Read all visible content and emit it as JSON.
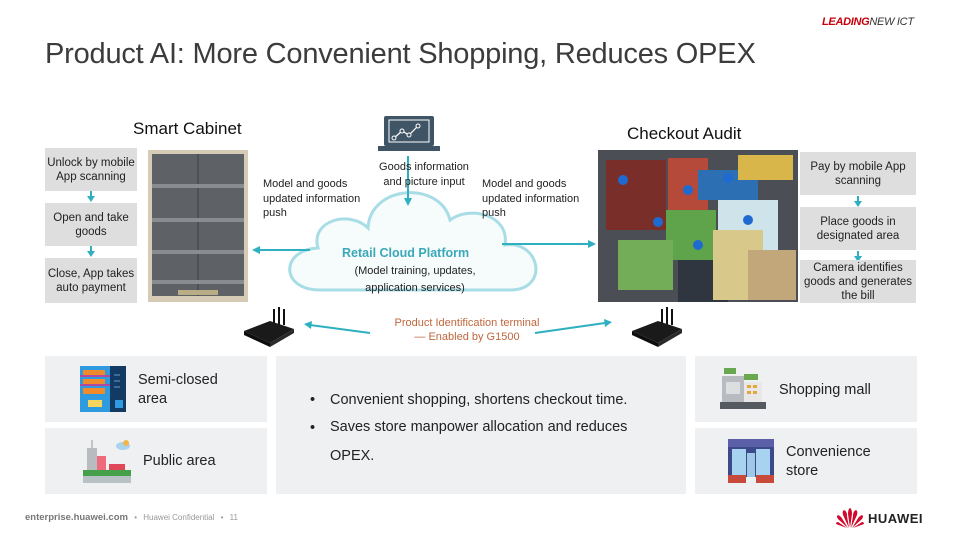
{
  "header": {
    "tagline_part1": "LEADING",
    "tagline_part2": "NEW ICT",
    "title": "Product AI: More Convenient Shopping, Reduces OPEX"
  },
  "smart_cabinet": {
    "title": "Smart Cabinet",
    "steps": [
      {
        "label": "Unlock by mobile App scanning"
      },
      {
        "label": "Open and take goods"
      },
      {
        "label": "Close, App takes auto payment"
      }
    ]
  },
  "checkout_audit": {
    "title": "Checkout Audit",
    "steps": [
      {
        "label": "Pay by mobile App scanning"
      },
      {
        "label": "Place goods in designated area"
      },
      {
        "label": "Camera identifies goods and generates the bill"
      }
    ]
  },
  "cloud": {
    "input_label": "Goods information and picture input",
    "push_left": "Model and goods updated information push",
    "push_right": "Model and goods updated information push",
    "title": "Retail Cloud Platform",
    "subtitle": "(Model training, updates, application services)"
  },
  "terminal": {
    "line1": "Product Identification terminal",
    "line2": "— Enabled by G1500"
  },
  "scenarios_left": [
    {
      "label": "Semi-closed area",
      "icon": "vending-machine-icon"
    },
    {
      "label": "Public area",
      "icon": "public-building-icon"
    }
  ],
  "benefits": [
    "Convenient shopping, shortens checkout time.",
    "Saves store manpower allocation and reduces OPEX."
  ],
  "scenarios_right": [
    {
      "label": "Shopping mall",
      "icon": "cash-register-icon"
    },
    {
      "label": "Convenience store",
      "icon": "storefront-icon"
    }
  ],
  "footer": {
    "site": "enterprise.huawei.com",
    "confidential": "Huawei Confidential",
    "page": "11",
    "logo_text": "HUAWEI"
  },
  "colors": {
    "accent_teal": "#2fb0c0",
    "brand_red": "#c7000b",
    "terminal_text": "#c0663c"
  }
}
